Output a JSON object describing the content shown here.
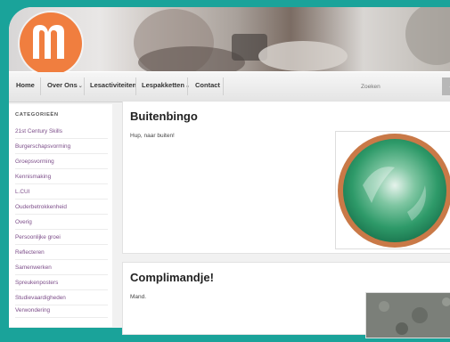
{
  "nav": {
    "items": [
      {
        "label": "Home"
      },
      {
        "label": "Over Ons"
      },
      {
        "label": "Lesactiviteiten"
      },
      {
        "label": "Lespakketten"
      },
      {
        "label": "Contact"
      }
    ],
    "search_placeholder": "Zoeken"
  },
  "sidebar": {
    "title": "CATEGORIEËN",
    "items": [
      {
        "label": "21st Century Skills"
      },
      {
        "label": "Burgerschapsvorming"
      },
      {
        "label": "Groepsvorming"
      },
      {
        "label": "Kennismaking"
      },
      {
        "label": "L.CUI"
      },
      {
        "label": "Ouderbetrokkenheid"
      },
      {
        "label": "Overig"
      },
      {
        "label": "Persoonlijke groei"
      },
      {
        "label": "Reflecteren"
      },
      {
        "label": "Samenwerken"
      },
      {
        "label": "Spreukenposters"
      },
      {
        "label": "Studievaardigheden"
      },
      {
        "label": "Verwondering"
      }
    ]
  },
  "posts": [
    {
      "title": "Buitenbingo",
      "body": "Hup, naar buiten!"
    },
    {
      "title": "Complimandje!",
      "body": "Mand."
    }
  ],
  "colors": {
    "background": "#1aa39a",
    "logo": "#f07e3f",
    "sidebar_link": "#7d4e8a"
  }
}
